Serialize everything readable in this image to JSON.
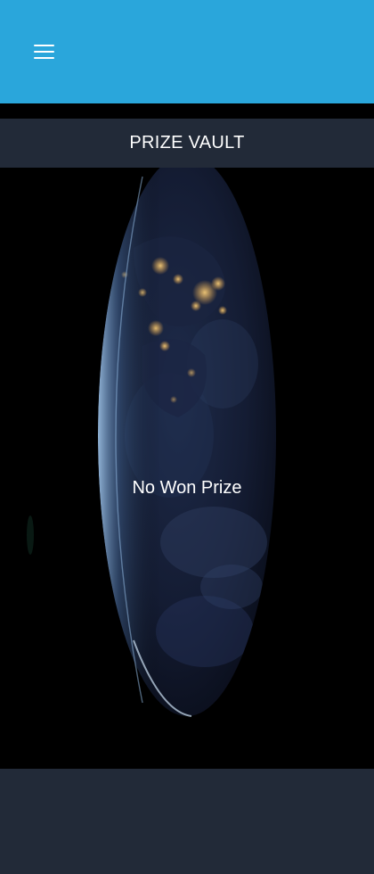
{
  "header": {
    "menu_icon": "hamburger-menu-icon",
    "background_color": "#2aa6db"
  },
  "vault": {
    "title": "PRIZE VAULT",
    "empty_message": "No Won Prize",
    "background_image": "earth-at-night-planet"
  },
  "colors": {
    "title_bar": "#222a38",
    "footer": "#222a38",
    "text": "#ffffff"
  }
}
